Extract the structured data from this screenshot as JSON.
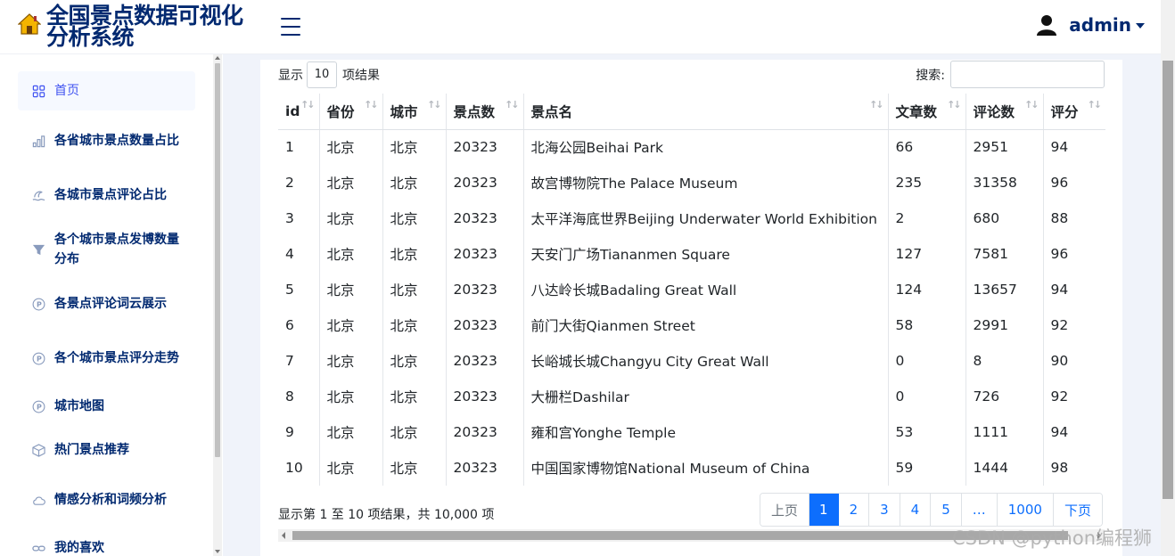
{
  "header": {
    "title": "全国景点数据可视化分析系统",
    "user": "admin"
  },
  "sidebar": {
    "items": [
      {
        "label": "首页",
        "icon": "grid-icon"
      },
      {
        "label": "各省城市景点数量占比",
        "icon": "bar-chart-icon"
      },
      {
        "label": "各城市景点评论占比",
        "icon": "wave-icon"
      },
      {
        "label": "各个城市景点发博数量分布",
        "icon": "funnel-icon"
      },
      {
        "label": "各景点评论词云展示",
        "icon": "circle-p-icon"
      },
      {
        "label": "各个城市景点评分走势",
        "icon": "circle-p-icon"
      },
      {
        "label": "城市地图",
        "icon": "circle-p-icon"
      },
      {
        "label": "热门景点推荐",
        "icon": "box-icon"
      },
      {
        "label": "情感分析和词频分析",
        "icon": "cloud-icon"
      },
      {
        "label": "我的喜欢",
        "icon": "link-icon"
      }
    ]
  },
  "table_controls": {
    "show_prefix": "显示",
    "page_length": "10",
    "show_suffix": "项结果",
    "search_label": "搜索:",
    "search_value": ""
  },
  "table": {
    "headers": [
      "id",
      "省份",
      "城市",
      "景点数",
      "景点名",
      "文章数",
      "评论数",
      "评分"
    ],
    "rows": [
      [
        "1",
        "北京",
        "北京",
        "20323",
        "北海公园Beihai Park",
        "66",
        "2951",
        "94"
      ],
      [
        "2",
        "北京",
        "北京",
        "20323",
        "故宫博物院The Palace Museum",
        "235",
        "31358",
        "96"
      ],
      [
        "3",
        "北京",
        "北京",
        "20323",
        "太平洋海底世界Beijing Underwater World Exhibition",
        "2",
        "680",
        "88"
      ],
      [
        "4",
        "北京",
        "北京",
        "20323",
        "天安门广场Tiananmen Square",
        "127",
        "7581",
        "96"
      ],
      [
        "5",
        "北京",
        "北京",
        "20323",
        "八达岭长城Badaling Great Wall",
        "124",
        "13657",
        "94"
      ],
      [
        "6",
        "北京",
        "北京",
        "20323",
        "前门大街Qianmen Street",
        "58",
        "2991",
        "92"
      ],
      [
        "7",
        "北京",
        "北京",
        "20323",
        "长峪城长城Changyu City Great Wall",
        "0",
        "8",
        "90"
      ],
      [
        "8",
        "北京",
        "北京",
        "20323",
        "大栅栏Dashilar",
        "0",
        "726",
        "92"
      ],
      [
        "9",
        "北京",
        "北京",
        "20323",
        "雍和宫Yonghe Temple",
        "53",
        "1111",
        "94"
      ],
      [
        "10",
        "北京",
        "北京",
        "20323",
        "中国国家博物馆National Museum of China",
        "59",
        "1444",
        "98"
      ]
    ]
  },
  "footer": {
    "info": "显示第 1 至 10 项结果，共 10,000 项",
    "pages": [
      "上页",
      "1",
      "2",
      "3",
      "4",
      "5",
      "…",
      "1000",
      "下页"
    ]
  },
  "watermark": "CSDN @python编程狮"
}
